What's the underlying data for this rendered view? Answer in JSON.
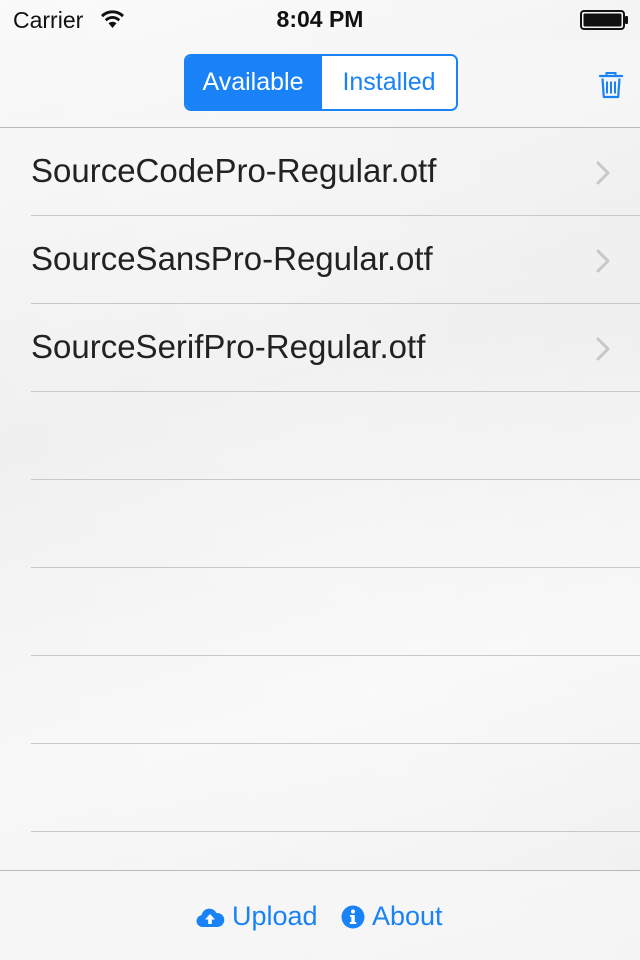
{
  "status_bar": {
    "carrier": "Carrier",
    "time": "8:04 PM"
  },
  "nav": {
    "segments": [
      {
        "label": "Available",
        "selected": true
      },
      {
        "label": "Installed",
        "selected": false
      }
    ],
    "trash_icon": "trash-icon"
  },
  "fonts": {
    "items": [
      {
        "label": "SourceCodePro-Regular.otf"
      },
      {
        "label": "SourceSansPro-Regular.otf"
      },
      {
        "label": "SourceSerifPro-Regular.otf"
      }
    ],
    "empty_rows": 5
  },
  "toolbar": {
    "upload_label": "Upload",
    "upload_icon": "cloud-upload-icon",
    "about_label": "About",
    "about_icon": "info-icon"
  },
  "colors": {
    "accent": "#1a82f7",
    "text": "#222222",
    "separator": "#c8c7cc"
  }
}
